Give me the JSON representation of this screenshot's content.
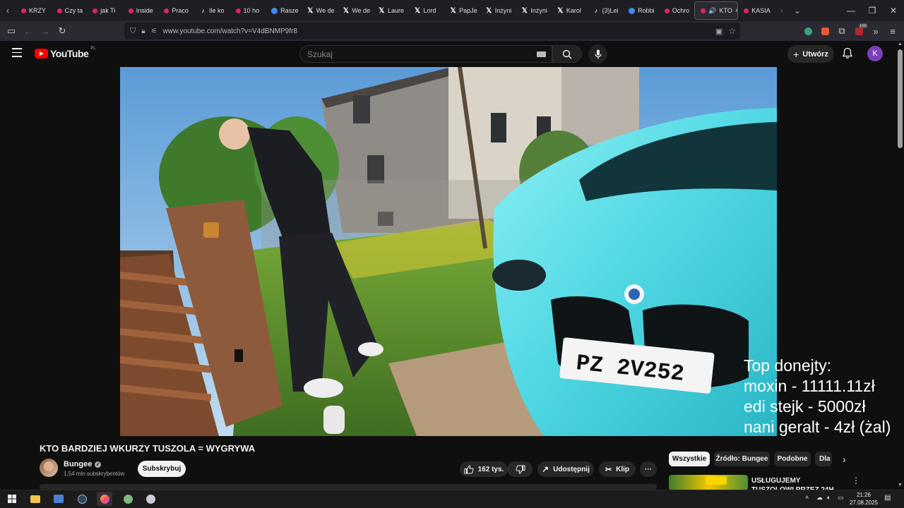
{
  "browser": {
    "tabs": [
      {
        "label": "KRZY",
        "icon": "youtube-icon"
      },
      {
        "label": "Czy ta",
        "icon": "youtube-icon"
      },
      {
        "label": "jak Ti",
        "icon": "youtube-icon"
      },
      {
        "label": "Inside",
        "icon": "youtube-icon"
      },
      {
        "label": "Praco",
        "icon": "youtube-icon"
      },
      {
        "label": "Ile ko",
        "icon": "tiktok-icon"
      },
      {
        "label": "10 ho",
        "icon": "youtube-icon"
      },
      {
        "label": "Rasze",
        "icon": "other-icon"
      },
      {
        "label": "We de",
        "icon": "x-icon"
      },
      {
        "label": "We de",
        "icon": "x-icon"
      },
      {
        "label": "Laure",
        "icon": "x-icon"
      },
      {
        "label": "Lord",
        "icon": "x-icon"
      },
      {
        "label": "PapJe",
        "icon": "x-icon"
      },
      {
        "label": "Inżyni",
        "icon": "x-icon"
      },
      {
        "label": "Inżyni",
        "icon": "x-icon"
      },
      {
        "label": "Karol",
        "icon": "x-icon"
      },
      {
        "label": "(3)Lei",
        "icon": "tiktok-icon"
      },
      {
        "label": "Robbi",
        "icon": "other-icon"
      },
      {
        "label": "Ochro",
        "icon": "youtube-icon"
      }
    ],
    "active_tab": {
      "label": "KTO",
      "close": "×"
    },
    "after_tab": {
      "label": "KASIA",
      "icon": "youtube-icon"
    },
    "url": "www.youtube.com/watch?v=V4dBNMP9fr8",
    "extensions_badge": "168"
  },
  "youtube": {
    "logo_text": "YouTube",
    "region": "PL",
    "search_placeholder": "Szukaj",
    "create_label": "Utwórz",
    "avatar_letter": "K"
  },
  "video": {
    "overlay_lines": [
      "Top donejty:",
      "moxin - 11111.11zł",
      "edi stejk - 5000zł",
      "nani geralt - 4zł (żal)"
    ],
    "plate": "PZ 2V252",
    "title": "KTO BARDZIEJ WKURZY TUSZOLA = WYGRYWA",
    "channel": "Bungee",
    "subscribers": "1,54 mln subskrybentów",
    "subscribe_label": "Subskrybuj",
    "likes": "162 tys.",
    "share_label": "Udostępnij",
    "clip_label": "Klip"
  },
  "sidebar": {
    "chips": [
      "Wszystkie",
      "Źródło: Bungee",
      "Podobne",
      "Dla"
    ],
    "recommended_title": "USŁUGUJEMY TUSZOLOWI PRZEZ 24H"
  },
  "taskbar": {
    "time": "21:26",
    "date": "27.08.2025"
  },
  "colors": {
    "yt_red": "#ff0000",
    "avatar": "#7b3fb8",
    "car": "#5ee0e8"
  }
}
